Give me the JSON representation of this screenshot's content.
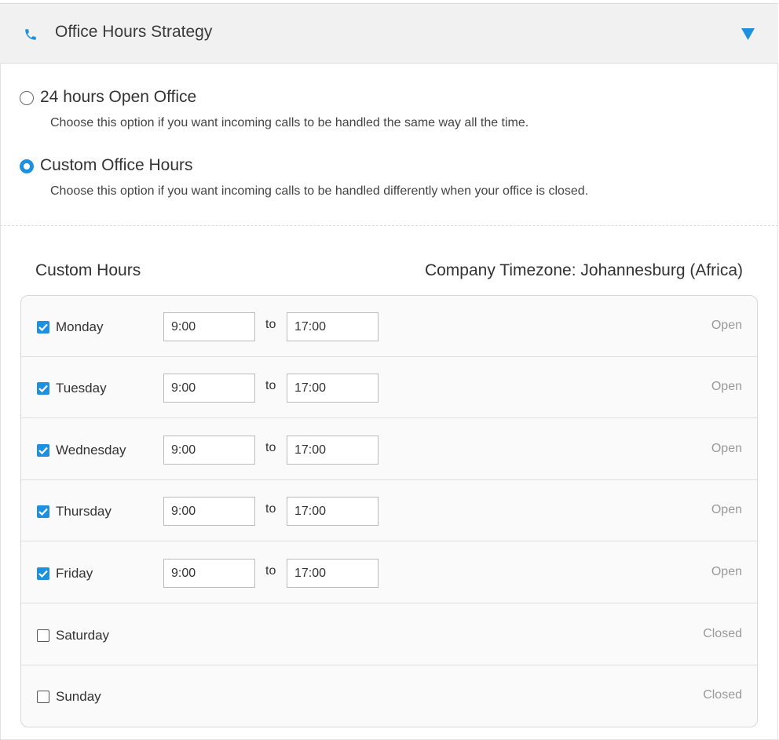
{
  "header": {
    "title": "Office Hours Strategy",
    "icon": "phone-icon",
    "toggle_icon": "triangle-down-icon",
    "accent": "#1e90e0"
  },
  "options": [
    {
      "label": "24 hours Open Office",
      "description": "Choose this option if you want incoming calls to be handled the same way all the time.",
      "selected": false
    },
    {
      "label": "Custom Office Hours",
      "description": "Choose this option if you want incoming calls to be handled differently when your office is closed.",
      "selected": true
    }
  ],
  "custom_hours": {
    "title": "Custom Hours",
    "timezone_label": "Company Timezone:",
    "timezone_value": "Johannesburg (Africa)",
    "to_label": "to",
    "days": [
      {
        "day": "Monday",
        "checked": true,
        "from": "9:00",
        "to": "17:00",
        "status": "Open"
      },
      {
        "day": "Tuesday",
        "checked": true,
        "from": "9:00",
        "to": "17:00",
        "status": "Open"
      },
      {
        "day": "Wednesday",
        "checked": true,
        "from": "9:00",
        "to": "17:00",
        "status": "Open"
      },
      {
        "day": "Thursday",
        "checked": true,
        "from": "9:00",
        "to": "17:00",
        "status": "Open"
      },
      {
        "day": "Friday",
        "checked": true,
        "from": "9:00",
        "to": "17:00",
        "status": "Open"
      },
      {
        "day": "Saturday",
        "checked": false,
        "status": "Closed"
      },
      {
        "day": "Sunday",
        "checked": false,
        "status": "Closed"
      }
    ]
  }
}
